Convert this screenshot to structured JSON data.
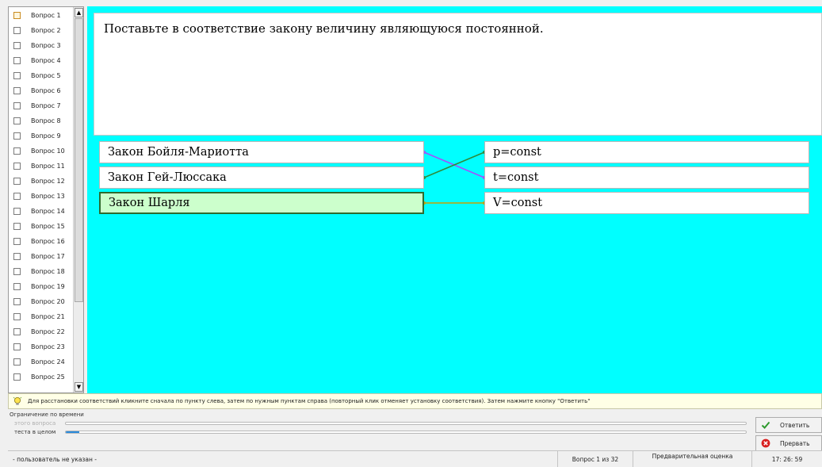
{
  "question_list": {
    "items": [
      {
        "label": "Вопрос 1",
        "current": true
      },
      {
        "label": "Вопрос 2"
      },
      {
        "label": "Вопрос 3"
      },
      {
        "label": "Вопрос 4"
      },
      {
        "label": "Вопрос 5"
      },
      {
        "label": "Вопрос 6"
      },
      {
        "label": "Вопрос 7"
      },
      {
        "label": "Вопрос 8"
      },
      {
        "label": "Вопрос 9"
      },
      {
        "label": "Вопрос 10"
      },
      {
        "label": "Вопрос 11"
      },
      {
        "label": "Вопрос 12"
      },
      {
        "label": "Вопрос 13"
      },
      {
        "label": "Вопрос 14"
      },
      {
        "label": "Вопрос 15"
      },
      {
        "label": "Вопрос 16"
      },
      {
        "label": "Вопрос 17"
      },
      {
        "label": "Вопрос 18"
      },
      {
        "label": "Вопрос 19"
      },
      {
        "label": "Вопрос 20"
      },
      {
        "label": "Вопрос 21"
      },
      {
        "label": "Вопрос 22"
      },
      {
        "label": "Вопрос 23"
      },
      {
        "label": "Вопрос 24"
      },
      {
        "label": "Вопрос 25"
      }
    ]
  },
  "question": {
    "text": "Поставьте в соответствие закону величину являющуюся постоянной."
  },
  "matching": {
    "left": [
      {
        "label": "Закон Бойля-Мариотта"
      },
      {
        "label": "Закон Гей-Люссака"
      },
      {
        "label": "Закон Шарля",
        "selected": true
      }
    ],
    "right": [
      {
        "label": "p=const"
      },
      {
        "label": "t=const"
      },
      {
        "label": "V=const"
      }
    ],
    "links": [
      {
        "from": 0,
        "to": 1,
        "color": "#a64dff"
      },
      {
        "from": 1,
        "to": 0,
        "color": "#2e8b3a"
      },
      {
        "from": 2,
        "to": 2,
        "color": "#c8a000"
      }
    ]
  },
  "hint": {
    "text": "Для расстановки соответствий кликните сначала по пункту слева, затем по нужным пунктам справа (повторный клик отменяет установку соответствия). Затем нажмите кнопку \"Ответить\""
  },
  "time_limit": {
    "title": "Ограничение по времени",
    "question_label": "этого вопроса",
    "test_label": "теста в целом",
    "question_progress": 0,
    "test_progress": 0.02
  },
  "actions": {
    "answer_label": "Ответить",
    "abort_label": "Прервать"
  },
  "status": {
    "user": "- пользователь не указан -",
    "question_counter": "Вопрос 1 из 32",
    "preliminary_grade": "Предварительная оценка",
    "clock": "17: 26: 59"
  },
  "colors": {
    "work_area": "#00ffff",
    "selected_cell": "#ccffcc",
    "progress": "#2a8bdc"
  }
}
